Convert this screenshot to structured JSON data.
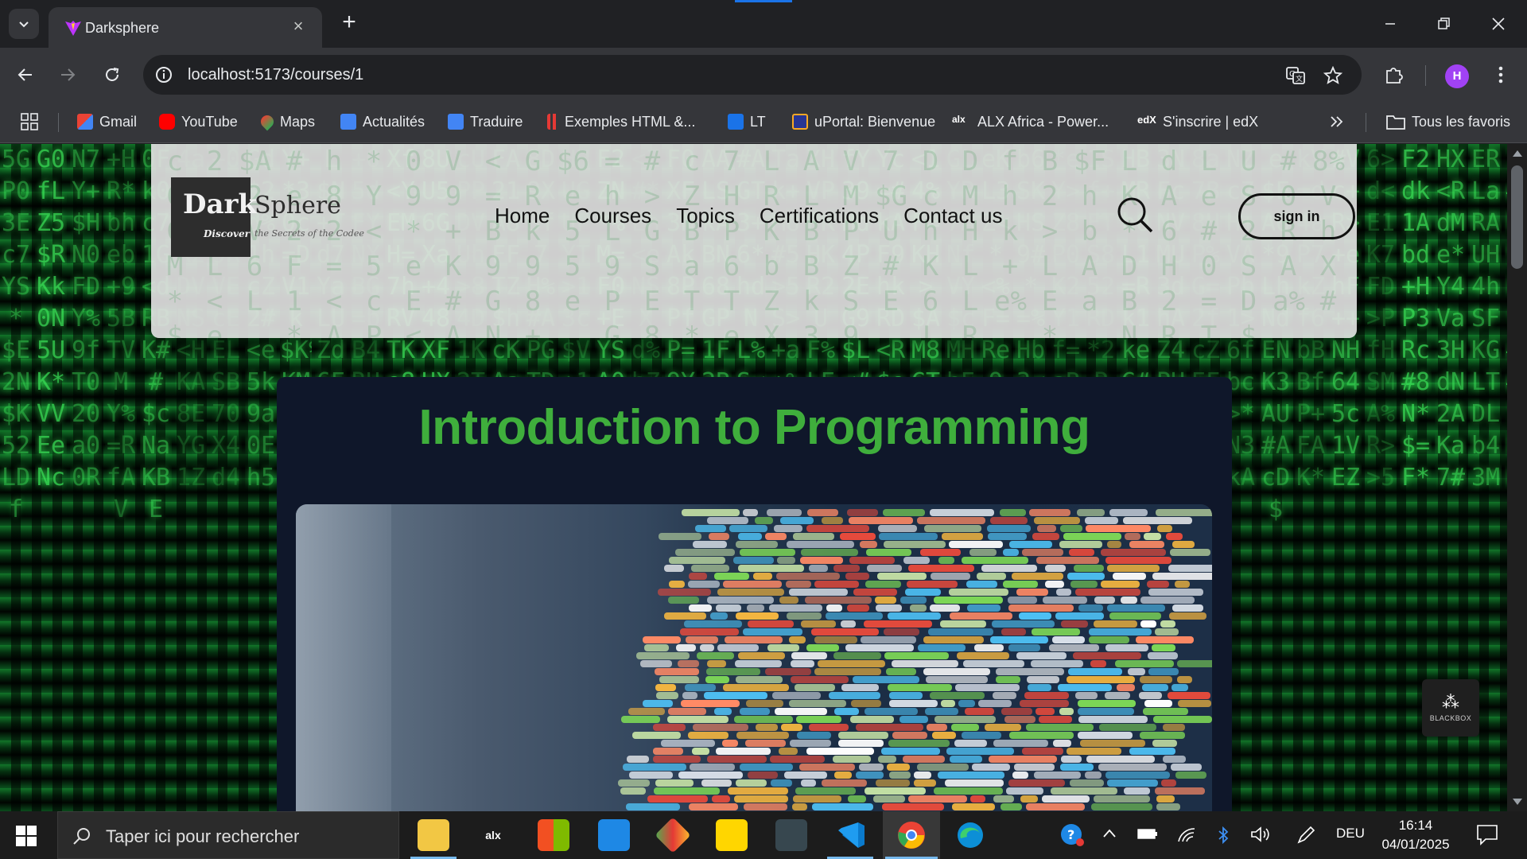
{
  "browser": {
    "tab_title": "Darksphere",
    "url": "localhost:5173/courses/1",
    "profile_initial": "H",
    "bookmarks": [
      {
        "label": "Gmail",
        "color": "#ea4335"
      },
      {
        "label": "YouTube",
        "color": "#ff0000"
      },
      {
        "label": "Maps",
        "color": "#34a853"
      },
      {
        "label": "Actualités",
        "color": "#4285f4"
      },
      {
        "label": "Traduire",
        "color": "#4285f4"
      },
      {
        "label": "Exemples HTML &...",
        "color": "#e53935"
      },
      {
        "label": "LT",
        "color": "#1a73e8"
      },
      {
        "label": "uPortal: Bienvenue",
        "color": "#f9a825"
      },
      {
        "label": "ALX Africa - Power...",
        "color": "#ffffff"
      },
      {
        "label": "S'inscrire | edX",
        "color": "#ffffff"
      }
    ],
    "all_bookmarks_label": "Tous les favoris"
  },
  "site": {
    "logo": {
      "dark": "Dark",
      "sphere": "Sphere",
      "tagline_bold": "Discover",
      "tagline_rest": "the Secrets of the Codee"
    },
    "nav": [
      "Home",
      "Courses",
      "Topics",
      "Certifications",
      "Contact us"
    ],
    "signin_label": "sign in",
    "course_title": "Introduction to Programming",
    "accent_color": "#3fae3c"
  },
  "overlay": {
    "blackbox_label": "BLACKBOX"
  },
  "taskbar": {
    "search_placeholder": "Taper ici pour rechercher",
    "language": "DEU",
    "time": "16:14",
    "date": "04/01/2025"
  }
}
